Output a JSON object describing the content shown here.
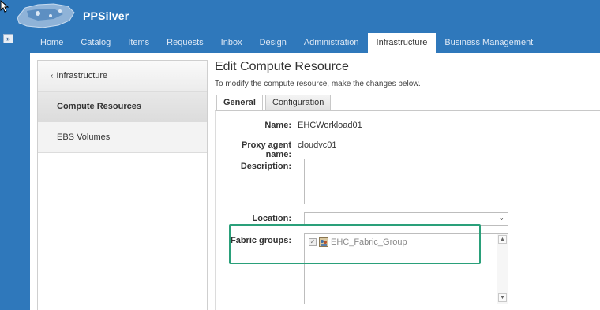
{
  "header": {
    "brand": "PPSilver",
    "expand_glyph": "»",
    "nav_tabs": [
      {
        "label": "Home"
      },
      {
        "label": "Catalog"
      },
      {
        "label": "Items"
      },
      {
        "label": "Requests"
      },
      {
        "label": "Inbox"
      },
      {
        "label": "Design"
      },
      {
        "label": "Administration"
      },
      {
        "label": "Infrastructure"
      },
      {
        "label": "Business Management"
      }
    ],
    "active_tab": "Infrastructure"
  },
  "sidebar": {
    "items": [
      {
        "label": "Infrastructure",
        "icon": "chevron-left-icon"
      },
      {
        "label": "Compute Resources"
      },
      {
        "label": "EBS Volumes"
      }
    ]
  },
  "main": {
    "title": "Edit Compute Resource",
    "description": "To modify the compute resource, make the changes below.",
    "tabs": [
      {
        "label": "General"
      },
      {
        "label": "Configuration"
      }
    ],
    "form": {
      "name_label": "Name:",
      "name_value": "EHCWorkload01",
      "proxy_label": "Proxy agent name:",
      "proxy_value": "cloudvc01",
      "description_label": "Description:",
      "description_value": "",
      "location_label": "Location:",
      "location_value": "",
      "fabric_label": "Fabric groups:",
      "fabric_groups": [
        {
          "label": "EHC_Fabric_Group",
          "checked": true
        }
      ]
    }
  },
  "colors": {
    "header_blue": "#2f78bb",
    "highlight_green": "#2aa07a"
  }
}
